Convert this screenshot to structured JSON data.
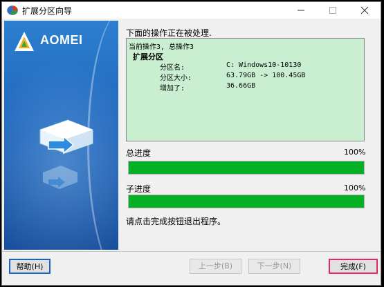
{
  "window": {
    "title": "扩展分区向导"
  },
  "banner": {
    "brand": "AOMEI"
  },
  "main": {
    "status_message": "下面的操作正在被处理.",
    "log": {
      "header": "当前操作3, 总操作3",
      "operation": "扩展分区",
      "rows": [
        {
          "label": "分区名:",
          "value": "C: Windows10-10130"
        },
        {
          "label": "分区大小:",
          "value": "63.79GB -> 100.45GB"
        },
        {
          "label": "增加了:",
          "value": "36.66GB"
        }
      ]
    },
    "total_progress": {
      "label": "总进度",
      "percent_text": "100%",
      "value": 1.0
    },
    "sub_progress": {
      "label": "子进度",
      "percent_text": "100%",
      "value": 1.0
    },
    "done_message": "请点击完成按钮退出程序。"
  },
  "buttons": {
    "help": "帮助(H)",
    "prev": "上一步(B)",
    "next": "下一步(N)",
    "finish": "完成(F)"
  },
  "colors": {
    "banner_blue": "#1e63b8",
    "progress_green": "#06b025",
    "log_bg": "#c9efd0"
  }
}
